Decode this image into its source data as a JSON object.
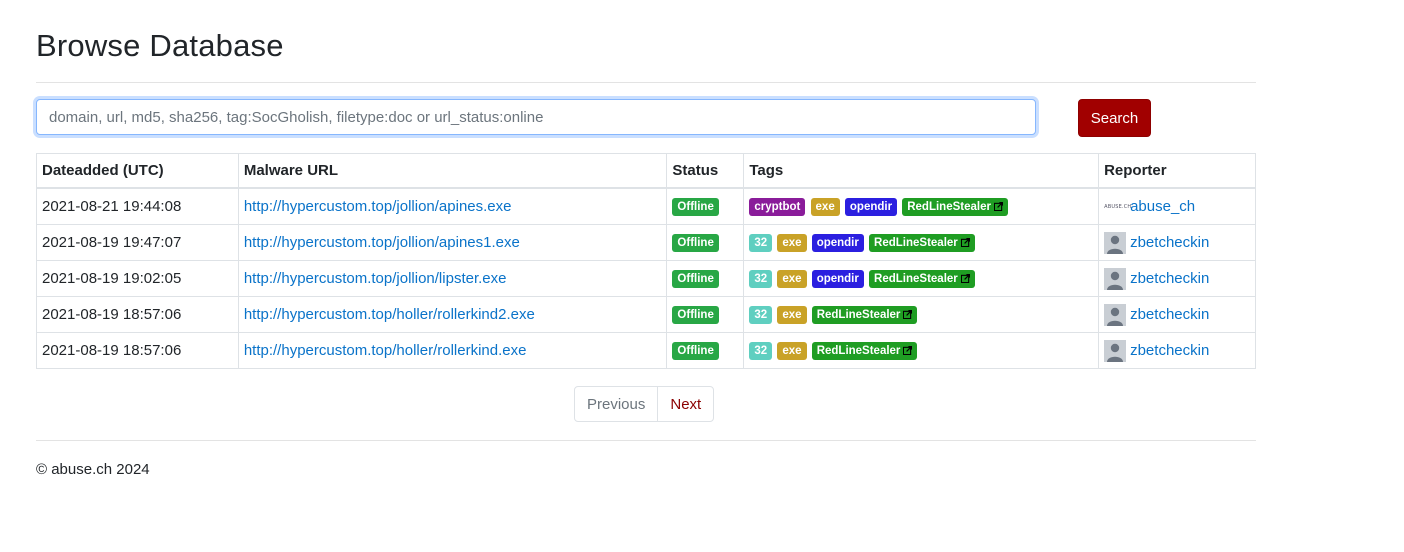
{
  "page": {
    "title": "Browse Database"
  },
  "search": {
    "placeholder": "domain, url, md5, sha256, tag:SocGholish, filetype:doc or url_status:online",
    "value": "",
    "button_label": "Search",
    "button_color": "#a10000"
  },
  "table": {
    "headers": [
      "Dateadded (UTC)",
      "Malware URL",
      "Status",
      "Tags",
      "Reporter"
    ],
    "rows": [
      {
        "date": "2021-08-21 19:44:08",
        "url": "http://hypercustom.top/jollion/apines.exe",
        "status": "Offline",
        "tags": [
          {
            "label": "cryptbot",
            "color": "#8a1c9a",
            "external": false
          },
          {
            "label": "exe",
            "color": "#c9a227",
            "external": false
          },
          {
            "label": "opendir",
            "color": "#2b1fe0",
            "external": false
          },
          {
            "label": "RedLineStealer",
            "color": "#1f9d23",
            "external": true
          }
        ],
        "reporter": "abuse_ch",
        "reporter_icon": "abuse-ch-logo-icon"
      },
      {
        "date": "2021-08-19 19:47:07",
        "url": "http://hypercustom.top/jollion/apines1.exe",
        "status": "Offline",
        "tags": [
          {
            "label": "32",
            "color": "#5fcfc0",
            "external": false
          },
          {
            "label": "exe",
            "color": "#c9a227",
            "external": false
          },
          {
            "label": "opendir",
            "color": "#2b1fe0",
            "external": false
          },
          {
            "label": "RedLineStealer",
            "color": "#1f9d23",
            "external": true
          }
        ],
        "reporter": "zbetcheckin",
        "reporter_icon": "user-avatar-icon"
      },
      {
        "date": "2021-08-19 19:02:05",
        "url": "http://hypercustom.top/jollion/lipster.exe",
        "status": "Offline",
        "tags": [
          {
            "label": "32",
            "color": "#5fcfc0",
            "external": false
          },
          {
            "label": "exe",
            "color": "#c9a227",
            "external": false
          },
          {
            "label": "opendir",
            "color": "#2b1fe0",
            "external": false
          },
          {
            "label": "RedLineStealer",
            "color": "#1f9d23",
            "external": true
          }
        ],
        "reporter": "zbetcheckin",
        "reporter_icon": "user-avatar-icon"
      },
      {
        "date": "2021-08-19 18:57:06",
        "url": "http://hypercustom.top/holler/rollerkind2.exe",
        "status": "Offline",
        "tags": [
          {
            "label": "32",
            "color": "#5fcfc0",
            "external": false
          },
          {
            "label": "exe",
            "color": "#c9a227",
            "external": false
          },
          {
            "label": "RedLineStealer",
            "color": "#1f9d23",
            "external": true
          }
        ],
        "reporter": "zbetcheckin",
        "reporter_icon": "user-avatar-icon"
      },
      {
        "date": "2021-08-19 18:57:06",
        "url": "http://hypercustom.top/holler/rollerkind.exe",
        "status": "Offline",
        "tags": [
          {
            "label": "32",
            "color": "#5fcfc0",
            "external": false
          },
          {
            "label": "exe",
            "color": "#c9a227",
            "external": false
          },
          {
            "label": "RedLineStealer",
            "color": "#1f9d23",
            "external": true
          }
        ],
        "reporter": "zbetcheckin",
        "reporter_icon": "user-avatar-icon"
      }
    ]
  },
  "status_color": "#28a745",
  "pagination": {
    "previous_label": "Previous",
    "next_label": "Next"
  },
  "footer": {
    "text": "© abuse.ch 2024"
  },
  "abuse_logo_text": "ABUSE.CH"
}
